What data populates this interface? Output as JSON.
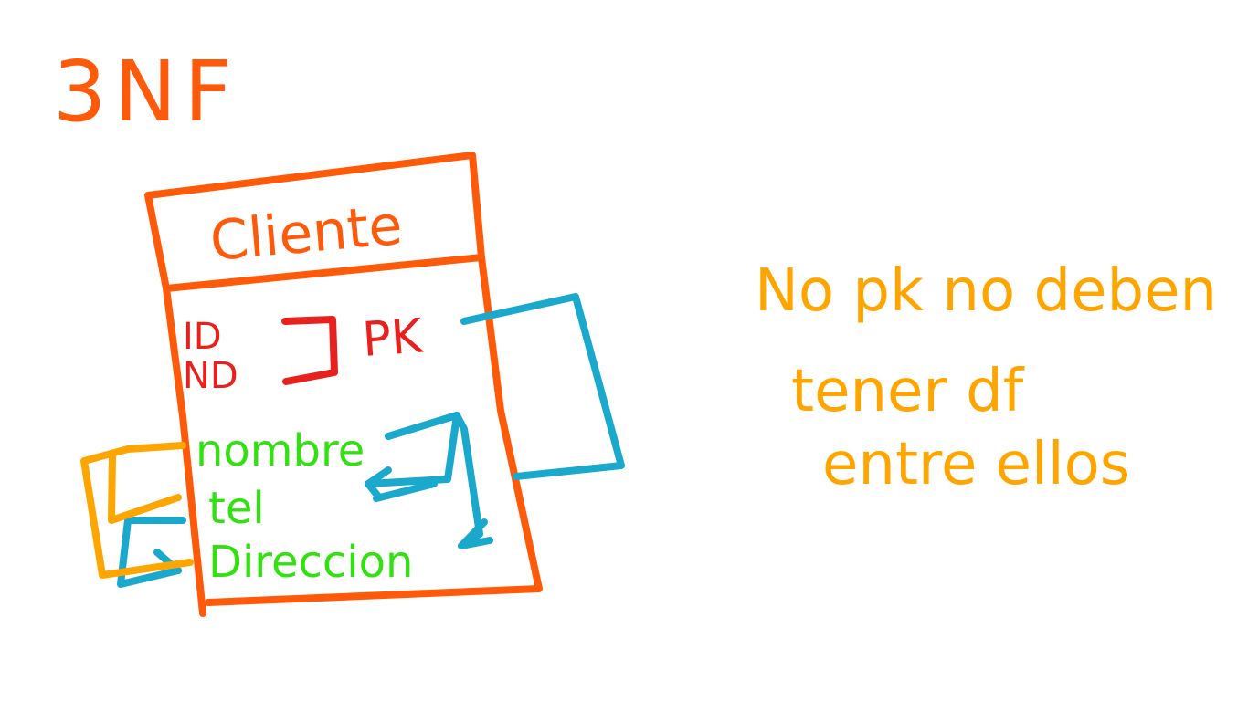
{
  "colors": {
    "background": "#ffffff",
    "orange": "#ff5a0a",
    "red": "#e8211f",
    "green": "#33e011",
    "blue": "#1aa8cc",
    "yellow": "#ffa500"
  },
  "title": "3NF",
  "entity": {
    "name": "Cliente",
    "key_attributes": [
      "ID",
      "ND"
    ],
    "key_label": "PK",
    "non_key_attributes": [
      "nombre",
      "tel",
      "Direccion"
    ]
  },
  "note": {
    "line1": "No pk  no deben",
    "line2": "tener df",
    "line3": "entre ellos"
  }
}
